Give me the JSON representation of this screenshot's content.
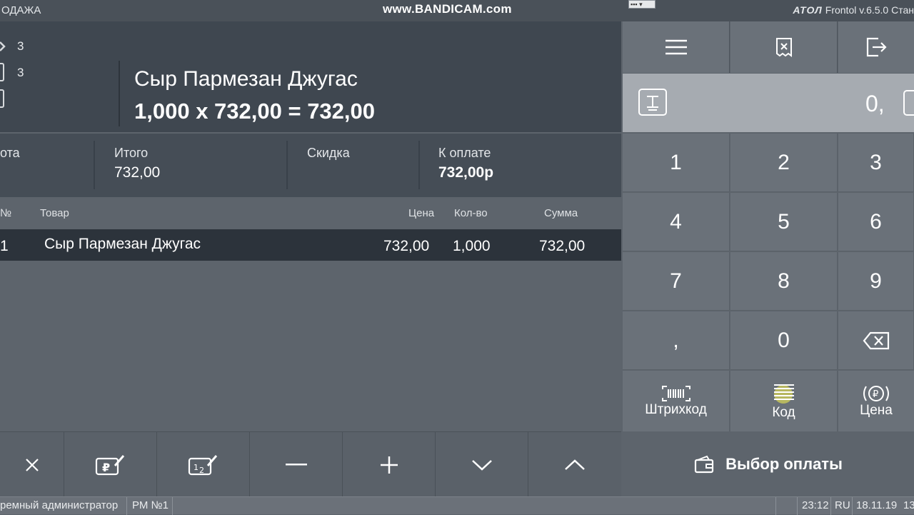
{
  "topbar": {
    "mode": "ОДАЖА",
    "watermark": "www.BANDICAM.com",
    "brand": "АТОЛ",
    "version": "Frontol v.6.5.0 Стан"
  },
  "item": {
    "count_a": "3",
    "count_b": "3",
    "name": "Сыр Пармезан Джугас",
    "calc": "1,000 x 732,00 = 732,00"
  },
  "totals": {
    "c1_label": "ота",
    "c2_label": "Итого",
    "c2_value": "732,00",
    "c3_label": "Скидка",
    "c4_label": "К оплате",
    "c4_value": "732,00р"
  },
  "table": {
    "headers": {
      "no": "№",
      "product": "Товар",
      "price": "Цена",
      "qty": "Кол-во",
      "sum": "Сумма"
    },
    "rows": [
      {
        "no": "1",
        "product": "Сыр Пармезан Джугас",
        "price": "732,00",
        "qty": "1,000",
        "sum": "732,00"
      }
    ]
  },
  "keypad": {
    "qty_value": "0,",
    "keys": [
      "1",
      "2",
      "3",
      "4",
      "5",
      "6",
      "7",
      "8",
      "9",
      ",",
      "0"
    ],
    "barcode_label": "Штрихкод",
    "code_label": "Код",
    "price_label": "Цена",
    "pay_label": "Выбор оплаты"
  },
  "status": {
    "user": "ремный администратор",
    "workplace": "РМ №1",
    "time": "23:12",
    "lang": "RU",
    "date": "18.11.19",
    "extra": "13"
  }
}
